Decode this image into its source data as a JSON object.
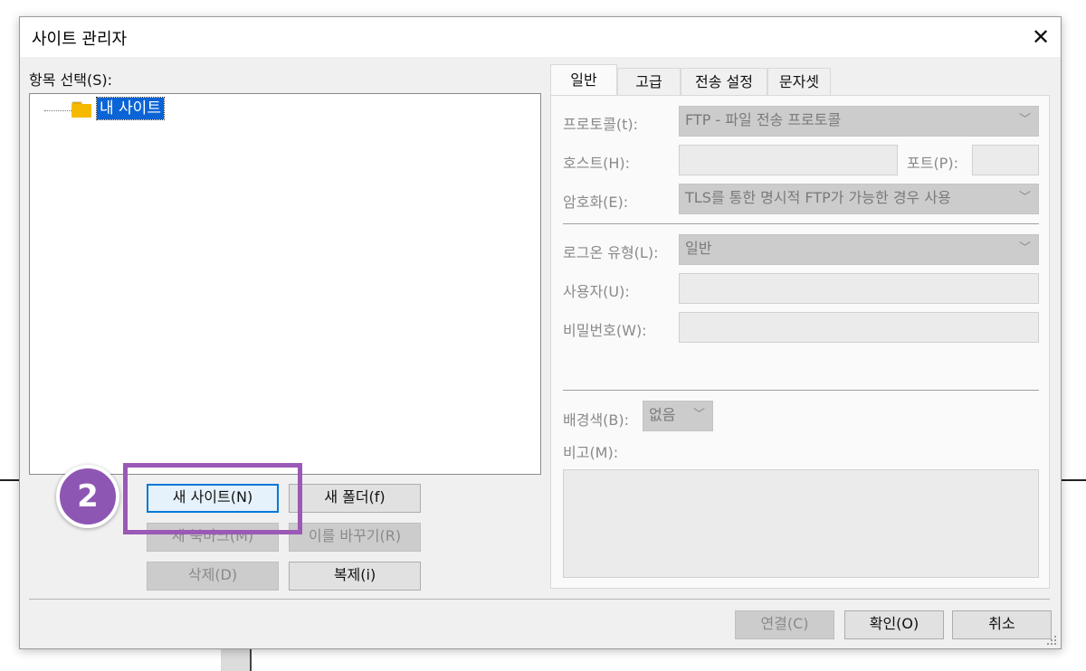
{
  "window": {
    "title": "사이트 관리자",
    "close_glyph": "✕"
  },
  "left": {
    "select_label": "항목 선택(S):",
    "tree_root": "내 사이트",
    "buttons": {
      "new_site": "새 사이트(N)",
      "new_folder": "새 폴더(f)",
      "new_bookmark": "새 북마크(M)",
      "rename": "이를 바꾸기(R)",
      "delete": "삭제(D)",
      "duplicate": "복제(i)"
    }
  },
  "tabs": [
    "일반",
    "고급",
    "전송 설정",
    "문자셋"
  ],
  "general": {
    "protocol_label": "프로토콜(t):",
    "protocol_value": "FTP - 파일 전송 프로토콜",
    "host_label": "호스트(H):",
    "host_value": "",
    "port_label": "포트(P):",
    "port_value": "",
    "encryption_label": "암호화(E):",
    "encryption_value": "TLS를 통한 명시적 FTP가 가능한 경우 사용",
    "logon_type_label": "로그온 유형(L):",
    "logon_type_value": "일반",
    "user_label": "사용자(U):",
    "user_value": "",
    "password_label": "비밀번호(W):",
    "password_value": "",
    "background_label": "배경색(B):",
    "background_value": "없음",
    "comments_label": "비고(M):",
    "comments_value": ""
  },
  "footer": {
    "connect": "연결(C)",
    "ok": "확인(O)",
    "cancel": "취소"
  },
  "annotation": {
    "step": "2",
    "color": "#9b59b6"
  },
  "icons": [
    "folder-icon",
    "close-icon",
    "chevron-down-icon",
    "scroll-up-icon",
    "scroll-down-icon",
    "resize-grip-icon"
  ]
}
